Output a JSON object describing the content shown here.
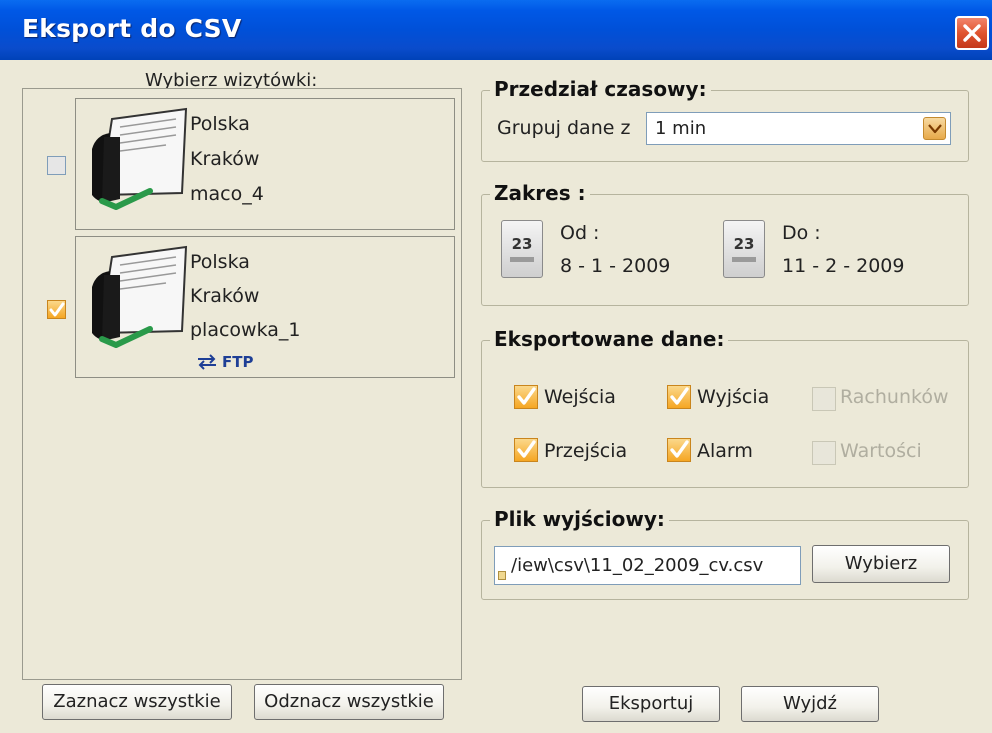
{
  "window": {
    "title": "Eksport do CSV"
  },
  "cards_label": "Wybierz wizytówki:",
  "cards": [
    {
      "country": "Polska",
      "city": "Kraków",
      "name": "maco_4",
      "checked": false,
      "badge": ""
    },
    {
      "country": "Polska",
      "city": "Kraków",
      "name": "placowka_1",
      "checked": true,
      "badge": "FTP"
    }
  ],
  "time_interval": {
    "title": "Przedział czasowy:",
    "group_label": "Grupuj dane z",
    "group_value": "1 min"
  },
  "range": {
    "title": "Zakres :",
    "from_label": "Od :",
    "from_value": "8 - 1 - 2009",
    "to_label": "Do :",
    "to_value": "11 - 2 - 2009",
    "calendar_day": "23"
  },
  "exported_data": {
    "title": "Eksportowane dane:",
    "options": [
      {
        "label": "Wejścia",
        "checked": true,
        "enabled": true
      },
      {
        "label": "Wyjścia",
        "checked": true,
        "enabled": true
      },
      {
        "label": "Rachunków",
        "checked": false,
        "enabled": false
      },
      {
        "label": "Przejścia",
        "checked": true,
        "enabled": true
      },
      {
        "label": "Alarm",
        "checked": true,
        "enabled": true
      },
      {
        "label": "Wartości",
        "checked": false,
        "enabled": false
      }
    ]
  },
  "output_file": {
    "title": "Plik wyjściowy:",
    "path": "/iew\\csv\\11_02_2009_cv.csv",
    "choose_label": "Wybierz"
  },
  "buttons": {
    "select_all": "Zaznacz wszystkie",
    "deselect_all": "Odznacz wszystkie",
    "export": "Eksportuj",
    "exit": "Wyjdź"
  },
  "colors": {
    "title_bar": "#0050d8",
    "close_button": "#e0542f",
    "checkbox_checked": "#f5a623",
    "dialog_background": "#ece9d8"
  },
  "icons": [
    "close-icon",
    "business-card-icon",
    "checkmark-icon",
    "ftp-transfer-icon",
    "calendar-icon",
    "dropdown-arrow-icon",
    "lock-icon"
  ]
}
